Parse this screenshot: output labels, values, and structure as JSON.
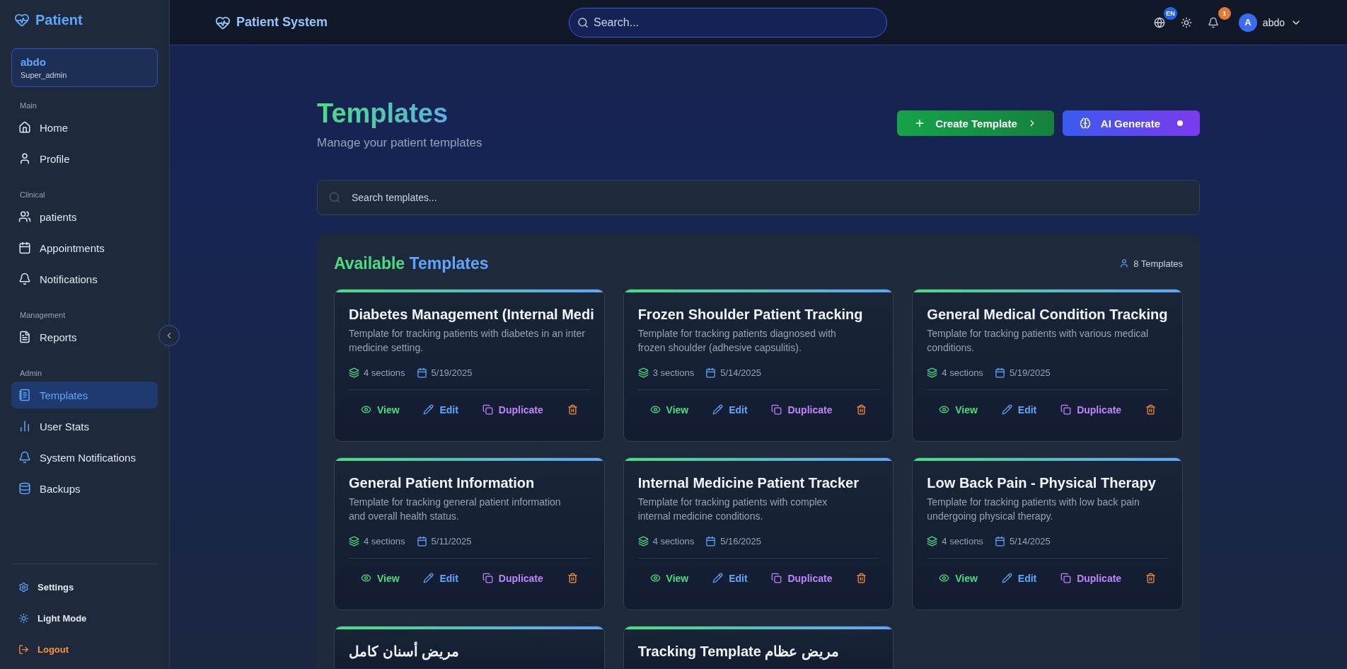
{
  "sidebar": {
    "brand": "Patient",
    "user": {
      "name": "abdo",
      "role": "Super_admin"
    },
    "groups": [
      {
        "title": "Main",
        "items": [
          {
            "label": "Home",
            "selected": false
          },
          {
            "label": "Profile",
            "selected": false
          }
        ]
      },
      {
        "title": "Clinical",
        "items": [
          {
            "label": "patients",
            "selected": false
          },
          {
            "label": "Appointments",
            "selected": false
          },
          {
            "label": "Notifications",
            "selected": false
          }
        ]
      },
      {
        "title": "Management",
        "items": [
          {
            "label": "Reports",
            "selected": false
          }
        ]
      },
      {
        "title": "Admin",
        "items": [
          {
            "label": "Templates",
            "selected": true
          },
          {
            "label": "User Stats",
            "selected": false
          },
          {
            "label": "System Notifications",
            "selected": false
          },
          {
            "label": "Backups",
            "selected": false
          }
        ]
      }
    ],
    "footer": [
      {
        "label": "Settings",
        "kind": "settings"
      },
      {
        "label": "Light Mode",
        "kind": "theme"
      },
      {
        "label": "Logout",
        "kind": "logout"
      }
    ]
  },
  "header": {
    "title": "Patient System",
    "search": {
      "placeholder": "Search..."
    },
    "language_badge": "EN",
    "notification_count": "1",
    "user": {
      "initial": "A",
      "name": "abdo"
    }
  },
  "page": {
    "title": "Templates",
    "subtitle": "Manage your patient templates",
    "actions": [
      {
        "label": "Create Template",
        "kind": "create"
      },
      {
        "label": "AI Generate",
        "kind": "ai"
      }
    ],
    "search": {
      "placeholder": "Search templates..."
    }
  },
  "templates": {
    "title_start": "Available",
    "title_end": "Templates",
    "count": "8 Templates",
    "cards": [
      {
        "title": "Diabetes Management (Internal Medi",
        "description_lines": [
          "Template for tracking patients with diabetes in an inter",
          "medicine setting."
        ],
        "sections": "4 sections",
        "date": "5/19/2025",
        "actions": [
          {
            "label": "View",
            "kind": "view"
          },
          {
            "label": "Edit",
            "kind": "edit"
          },
          {
            "label": "Duplicate",
            "kind": "duplicate"
          },
          {
            "kind": "delete"
          }
        ]
      },
      {
        "title": "Frozen Shoulder Patient Tracking",
        "description_lines": [
          "Template for tracking patients diagnosed with",
          "frozen shoulder (adhesive capsulitis)."
        ],
        "sections": "3 sections",
        "date": "5/14/2025",
        "actions": [
          {
            "label": "View",
            "kind": "view"
          },
          {
            "label": "Edit",
            "kind": "edit"
          },
          {
            "label": "Duplicate",
            "kind": "duplicate"
          },
          {
            "kind": "delete"
          }
        ]
      },
      {
        "title": "General Medical Condition Tracking",
        "description_lines": [
          "Template for tracking patients with various medical",
          "conditions."
        ],
        "sections": "4 sections",
        "date": "5/19/2025",
        "actions": [
          {
            "label": "View",
            "kind": "view"
          },
          {
            "label": "Edit",
            "kind": "edit"
          },
          {
            "label": "Duplicate",
            "kind": "duplicate"
          },
          {
            "kind": "delete"
          }
        ]
      },
      {
        "title": "General Patient Information",
        "description_lines": [
          "Template for tracking general patient information",
          "and overall health status."
        ],
        "sections": "4 sections",
        "date": "5/11/2025",
        "actions": [
          {
            "label": "View",
            "kind": "view"
          },
          {
            "label": "Edit",
            "kind": "edit"
          },
          {
            "label": "Duplicate",
            "kind": "duplicate"
          },
          {
            "kind": "delete"
          }
        ]
      },
      {
        "title": "Internal Medicine Patient Tracker",
        "description_lines": [
          "Template for tracking patients with complex",
          "internal medicine conditions."
        ],
        "sections": "4 sections",
        "date": "5/16/2025",
        "actions": [
          {
            "label": "View",
            "kind": "view"
          },
          {
            "label": "Edit",
            "kind": "edit"
          },
          {
            "label": "Duplicate",
            "kind": "duplicate"
          },
          {
            "kind": "delete"
          }
        ]
      },
      {
        "title": "Low Back Pain - Physical Therapy",
        "description_lines": [
          "Template for tracking patients with low back pain",
          "undergoing physical therapy."
        ],
        "sections": "4 sections",
        "date": "5/14/2025",
        "actions": [
          {
            "label": "View",
            "kind": "view"
          },
          {
            "label": "Edit",
            "kind": "edit"
          },
          {
            "label": "Duplicate",
            "kind": "duplicate"
          },
          {
            "kind": "delete"
          }
        ]
      },
      {
        "title": "مريض أسنان كامل"
      },
      {
        "title": "مريض عظام Tracking Template"
      }
    ]
  }
}
